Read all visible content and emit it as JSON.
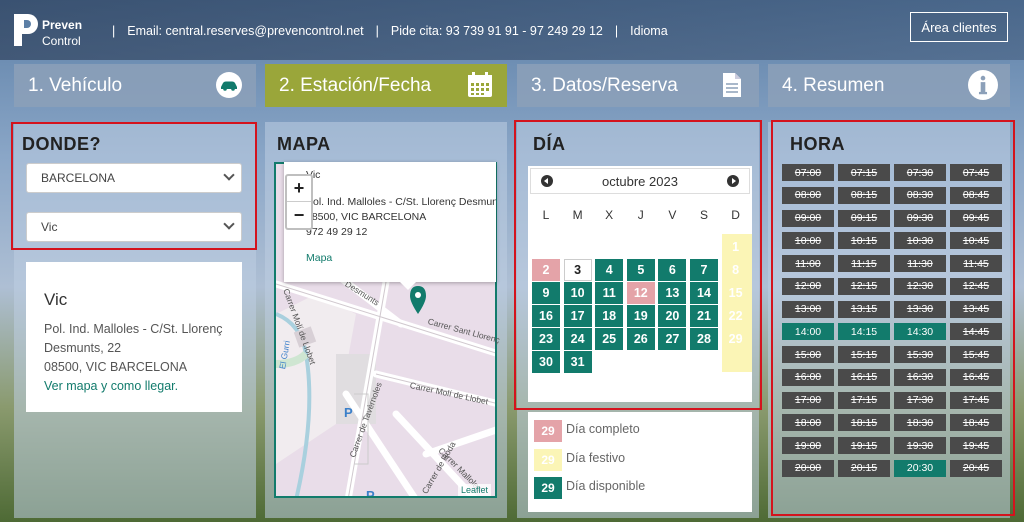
{
  "header": {
    "logo_line1": "Preven",
    "logo_line2": "Control",
    "email": "Email: central.reserves@prevencontrol.net",
    "phone": "Pide cita: 93 739 91 91 - 97 249 29 12",
    "language": "Idioma",
    "area_button": "Área clientes"
  },
  "steps": [
    {
      "label": "1. Vehículo",
      "icon": "car-icon"
    },
    {
      "label": "2. Estación/Fecha",
      "icon": "calendar-icon",
      "active": true
    },
    {
      "label": "3. Datos/Reserva",
      "icon": "document-icon"
    },
    {
      "label": "4. Resumen",
      "icon": "info-icon"
    }
  ],
  "donde": {
    "title": "DONDE?",
    "province": "BARCELONA",
    "city": "Vic",
    "station": {
      "name": "Vic",
      "line1": "Pol. Ind. Malloles - C/St. Llorenç",
      "line2": "Desmunts, 22",
      "line3": "08500, VIC BARCELONA",
      "link": "Ver mapa y como llegar."
    }
  },
  "mapa": {
    "title": "MAPA",
    "popup_line0": "Vic",
    "popup_line1": "Pol. Ind. Malloles - C/St. Llorenç Desmunts, 22",
    "popup_line2": "08500, VIC BARCELONA",
    "popup_line3": "972 49 29 12",
    "popup_link": "Mapa",
    "zoom_in": "+",
    "zoom_out": "−",
    "attribution": "Leaflet",
    "streets": [
      "Carrer Molí de Llobet",
      "Carrer Sant Llorenç",
      "Desmunts",
      "Carrer Molí de Llobet",
      "Carrer de Tavèrnoles",
      "Carrer Malloles",
      "Carrer de Roda",
      "El Gurri"
    ]
  },
  "dia": {
    "title": "DÍA",
    "month": "octubre 2023",
    "weekdays": [
      "L",
      "M",
      "X",
      "J",
      "V",
      "S",
      "D"
    ],
    "days": [
      {
        "d": "1",
        "s": "fest"
      },
      {
        "d": "2",
        "s": "full"
      },
      {
        "d": "3",
        "s": "today"
      },
      {
        "d": "4",
        "s": "av"
      },
      {
        "d": "5",
        "s": "av"
      },
      {
        "d": "6",
        "s": "av"
      },
      {
        "d": "7",
        "s": "av"
      },
      {
        "d": "8",
        "s": "fest"
      },
      {
        "d": "9",
        "s": "av"
      },
      {
        "d": "10",
        "s": "av"
      },
      {
        "d": "11",
        "s": "av"
      },
      {
        "d": "12",
        "s": "full"
      },
      {
        "d": "13",
        "s": "av"
      },
      {
        "d": "14",
        "s": "av"
      },
      {
        "d": "15",
        "s": "fest"
      },
      {
        "d": "16",
        "s": "av"
      },
      {
        "d": "17",
        "s": "av"
      },
      {
        "d": "18",
        "s": "av"
      },
      {
        "d": "19",
        "s": "av"
      },
      {
        "d": "20",
        "s": "av"
      },
      {
        "d": "21",
        "s": "av"
      },
      {
        "d": "22",
        "s": "fest"
      },
      {
        "d": "23",
        "s": "av"
      },
      {
        "d": "24",
        "s": "av"
      },
      {
        "d": "25",
        "s": "av"
      },
      {
        "d": "26",
        "s": "av"
      },
      {
        "d": "27",
        "s": "av"
      },
      {
        "d": "28",
        "s": "av"
      },
      {
        "d": "29",
        "s": "fest"
      },
      {
        "d": "30",
        "s": "av"
      },
      {
        "d": "31",
        "s": "av"
      }
    ],
    "legend": [
      {
        "num": "29",
        "label": "Día completo",
        "s": "full"
      },
      {
        "num": "29",
        "label": "Día festivo",
        "s": "fest"
      },
      {
        "num": "29",
        "label": "Día disponible",
        "s": "av"
      }
    ]
  },
  "hora": {
    "title": "HORA",
    "slots": [
      "07:00",
      "07:15",
      "07:30",
      "07:45",
      "08:00",
      "08:15",
      "08:30",
      "08:45",
      "09:00",
      "09:15",
      "09:30",
      "09:45",
      "10:00",
      "10:15",
      "10:30",
      "10:45",
      "11:00",
      "11:15",
      "11:30",
      "11:45",
      "12:00",
      "12:15",
      "12:30",
      "12:45",
      "13:00",
      "13:15",
      "13:30",
      "13:45",
      "14:00",
      "14:15",
      "14:30",
      "14:45",
      "15:00",
      "15:15",
      "15:30",
      "15:45",
      "16:00",
      "16:15",
      "16:30",
      "16:45",
      "17:00",
      "17:15",
      "17:30",
      "17:45",
      "18:00",
      "18:15",
      "18:30",
      "18:45",
      "19:00",
      "19:15",
      "19:30",
      "19:45",
      "20:00",
      "20:15",
      "20:30",
      "20:45"
    ],
    "available": [
      "14:00",
      "14:15",
      "14:30",
      "20:30"
    ]
  },
  "colors": {
    "accent": "#127b6c",
    "active_step": "#9aa63a",
    "highlight_border": "#d4131d",
    "full_day": "#e4a3a8",
    "holiday": "#fbf5b6"
  }
}
